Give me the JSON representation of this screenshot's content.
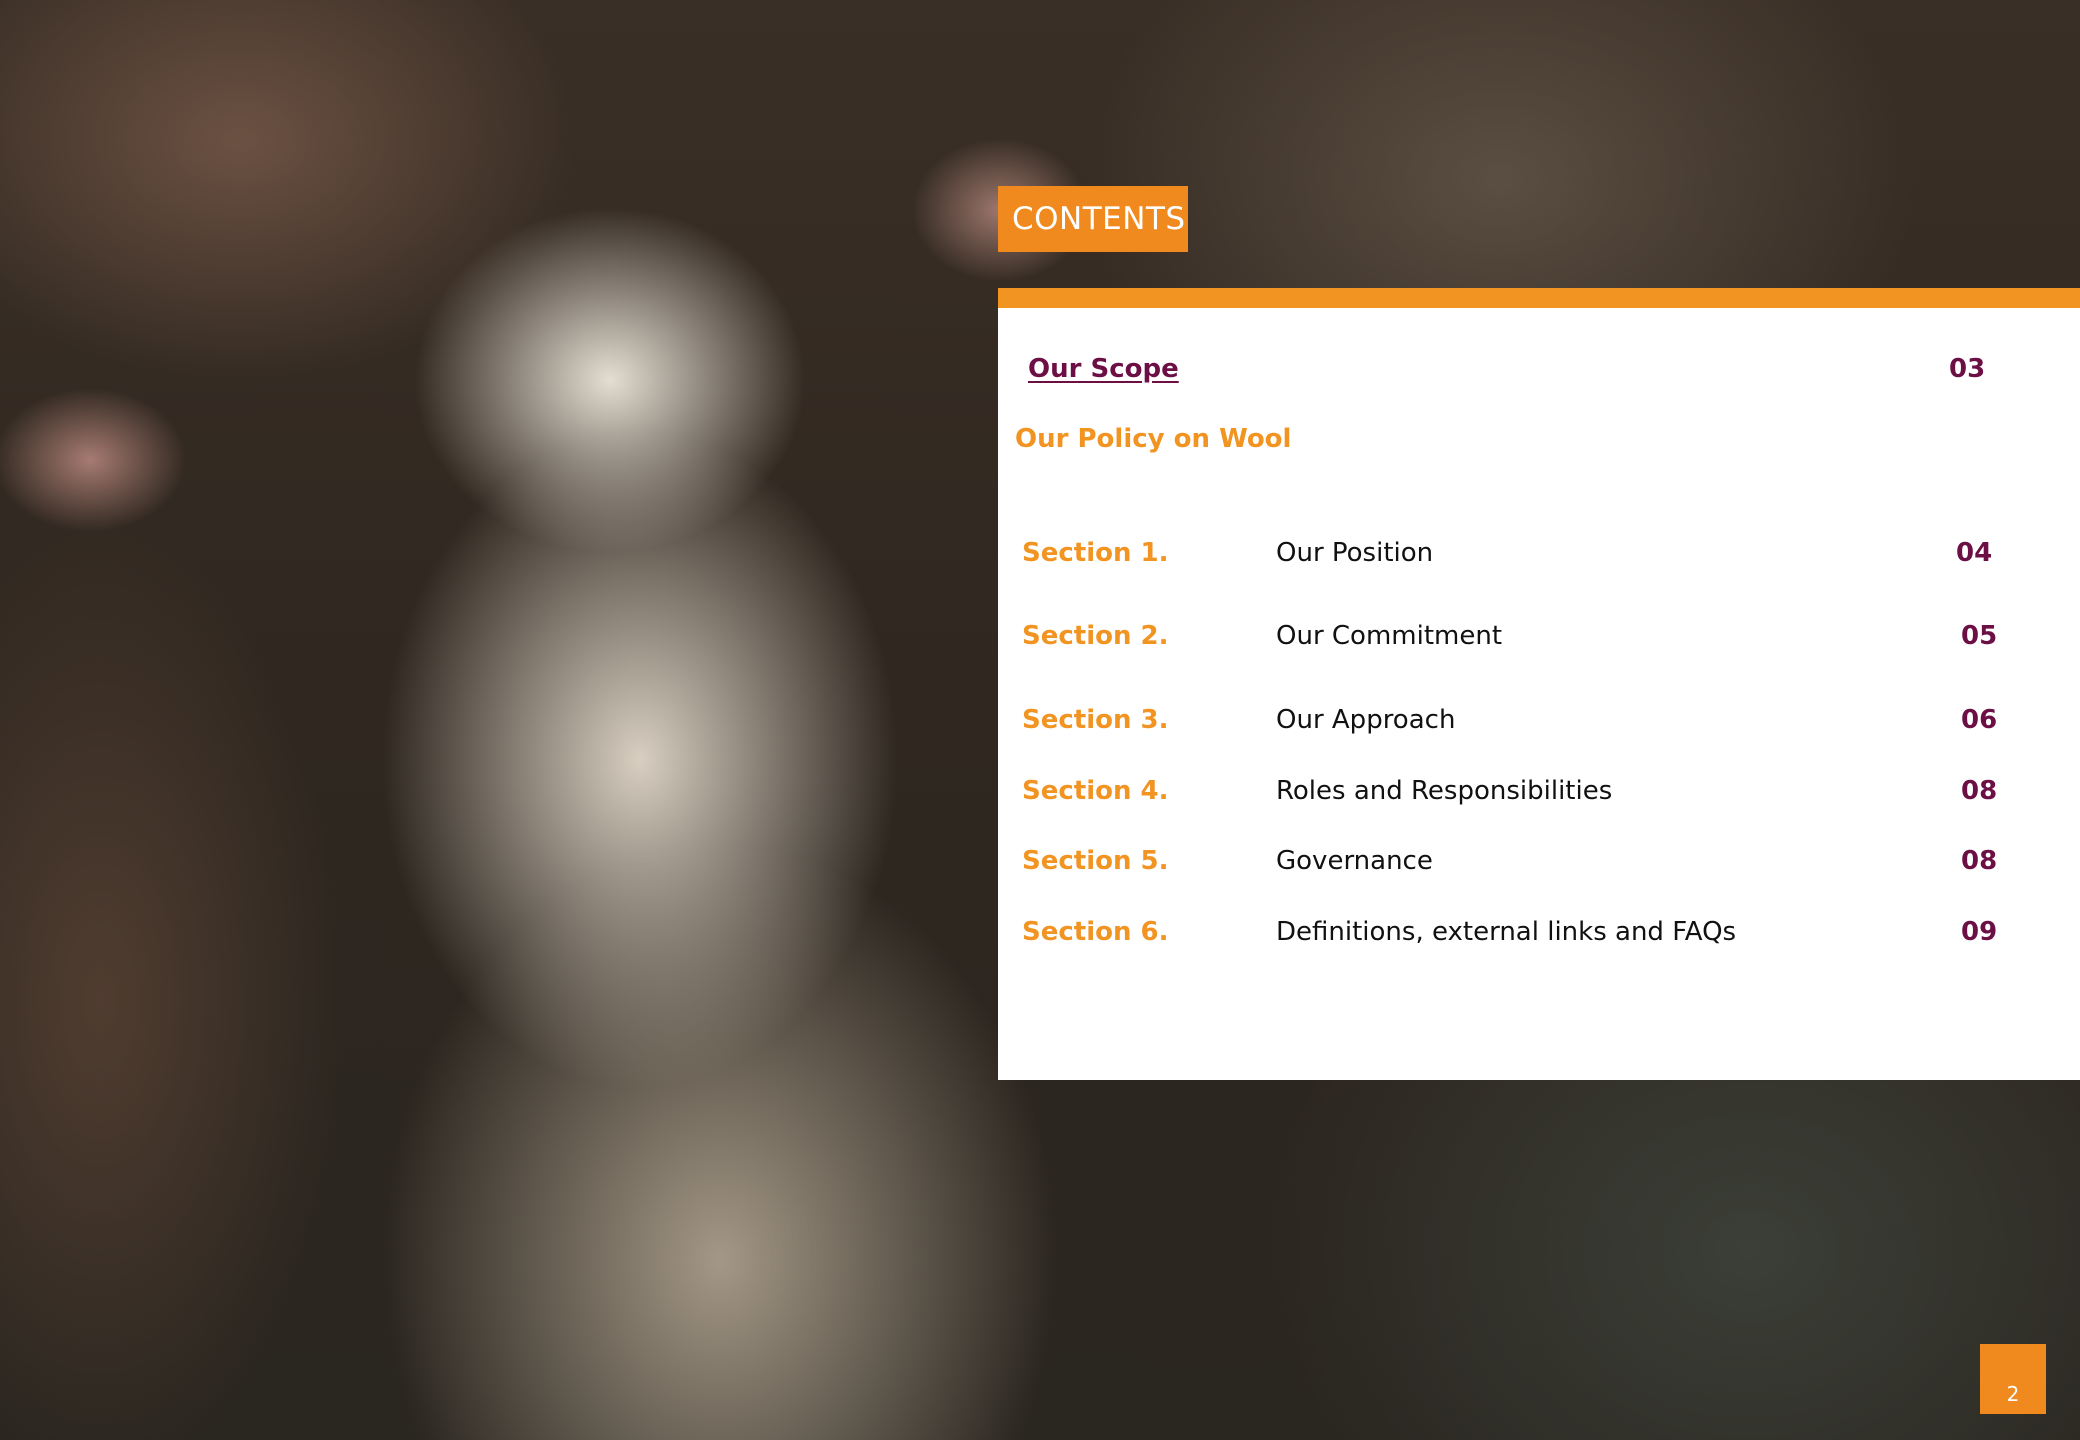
{
  "header": {
    "contents_label": "CONTENTS"
  },
  "toc": {
    "scope": {
      "label": "Our Scope",
      "page": "03"
    },
    "policy_heading": "Our Policy on Wool",
    "sections": [
      {
        "label": "Section 1.",
        "title": "Our Position",
        "page": "04"
      },
      {
        "label": "Section 2.",
        "title": "Our Commitment",
        "page": "05"
      },
      {
        "label": "Section 3.",
        "title": "Our Approach",
        "page": "06"
      },
      {
        "label": "Section 4.",
        "title": "Roles and Responsibilities",
        "page": "08"
      },
      {
        "label": "Section 5.",
        "title": "Governance",
        "page": "08"
      },
      {
        "label": "Section 6.",
        "title": " Definitions, external links and FAQs",
        "page": "09"
      }
    ]
  },
  "footer": {
    "page_number": "2"
  },
  "colors": {
    "orange": "#f29422",
    "plum": "#6b0f45",
    "text": "#111111"
  }
}
